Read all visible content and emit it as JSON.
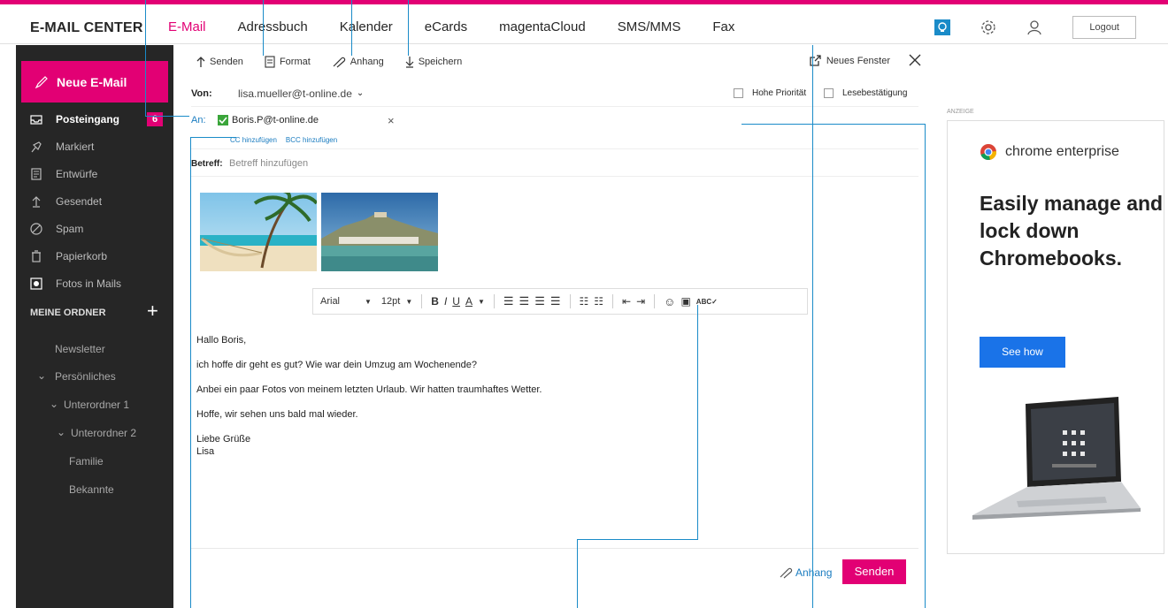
{
  "brand": "E-MAIL CENTER",
  "nav": [
    "E-Mail",
    "Adressbuch",
    "Kalender",
    "eCards",
    "magentaCloud",
    "SMS/MMS",
    "Fax"
  ],
  "top_right": {
    "logout": "Logout"
  },
  "sidebar": {
    "new_mail": "Neue E-Mail",
    "folders": [
      {
        "label": "Posteingang",
        "icon": "inbox-icon",
        "badge": "6"
      },
      {
        "label": "Markiert",
        "icon": "pin-icon"
      },
      {
        "label": "Entwürfe",
        "icon": "drafts-icon"
      },
      {
        "label": "Gesendet",
        "icon": "sent-icon"
      },
      {
        "label": "Spam",
        "icon": "spam-icon"
      },
      {
        "label": "Papierkorb",
        "icon": "trash-icon"
      },
      {
        "label": "Fotos in Mails",
        "icon": "photo-icon"
      }
    ],
    "my_folders": "MEINE ORDNER",
    "subfolders": [
      "Newsletter",
      "Persönliches",
      "Unterordner 1",
      "Unterordner 2",
      "Familie",
      "Bekannte"
    ]
  },
  "compose": {
    "toolbar": {
      "send": "Senden",
      "format": "Format",
      "attach": "Anhang",
      "save": "Speichern",
      "new_window": "Neues Fenster"
    },
    "from_label": "Von:",
    "from_value": "lisa.mueller@t-online.de",
    "high_priority": "Hohe Priorität",
    "read_receipt": "Lesebestätigung",
    "to_label": "An:",
    "to_value": "Boris.P@t-online.de",
    "cc_add": "CC hinzufügen",
    "bcc_add": "BCC hinzufügen",
    "subject_label": "Betreff:",
    "subject_placeholder": "Betreff hinzufügen",
    "format_bar": {
      "font": "Arial",
      "size": "12pt"
    },
    "body": [
      "Hallo Boris,",
      "ich hoffe dir geht es gut? Wie war dein Umzug am Wochenende?",
      "Anbei ein paar Fotos von meinem letzten Urlaub. Wir hatten traumhaftes Wetter.",
      "Hoffe, wir sehen uns bald mal wieder."
    ],
    "signoff": [
      "Liebe Grüße",
      "Lisa"
    ],
    "attach_bottom": "Anhang",
    "send_bottom": "Senden"
  },
  "ad": {
    "label": "ANZEIGE",
    "brand": "chrome enterprise",
    "headline": "Easily manage and lock down Chromebooks.",
    "cta": "See how"
  },
  "colors": {
    "magenta": "#e20074",
    "sidebar": "#262626",
    "link": "#1a7cc0",
    "cta_blue": "#1a73e8"
  }
}
